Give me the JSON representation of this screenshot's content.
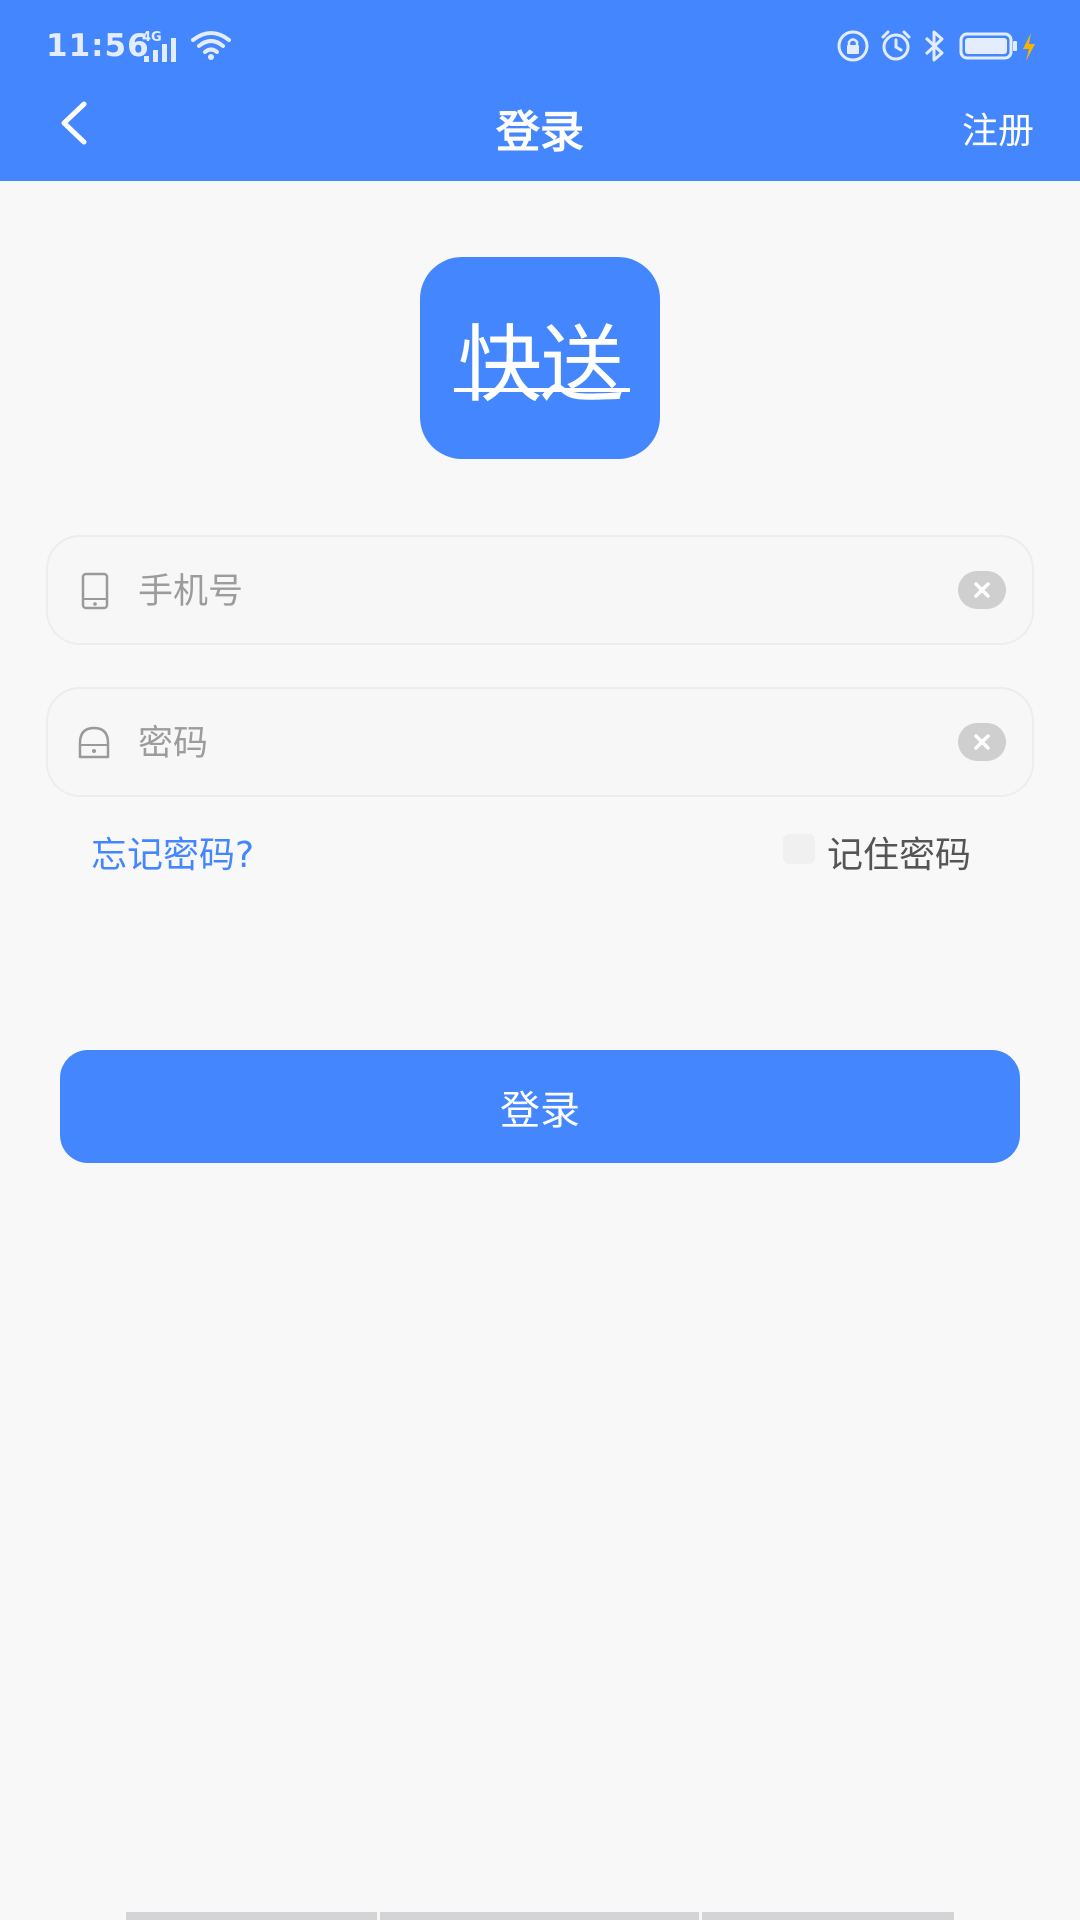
{
  "status_bar": {
    "time": "11:56",
    "network": "4G",
    "icons": [
      "signal-icon",
      "wifi-icon",
      "lock-rotation-icon",
      "alarm-icon",
      "bluetooth-icon",
      "battery-icon",
      "charging-icon"
    ]
  },
  "nav": {
    "back_icon": "chevron-left-icon",
    "title": "登录",
    "register_label": "注册"
  },
  "logo": {
    "text": "快送"
  },
  "form": {
    "phone": {
      "icon": "phone-icon",
      "value": "",
      "placeholder": "手机号",
      "clear_icon": "clear-icon"
    },
    "password": {
      "icon": "lock-icon",
      "value": "",
      "placeholder": "密码",
      "clear_icon": "clear-icon"
    },
    "forgot_label": "忘记密码?",
    "remember_label": "记住密码",
    "remember_checked": false,
    "submit_label": "登录"
  },
  "colors": {
    "primary": "#4486fe",
    "background": "#f8f8f9"
  }
}
